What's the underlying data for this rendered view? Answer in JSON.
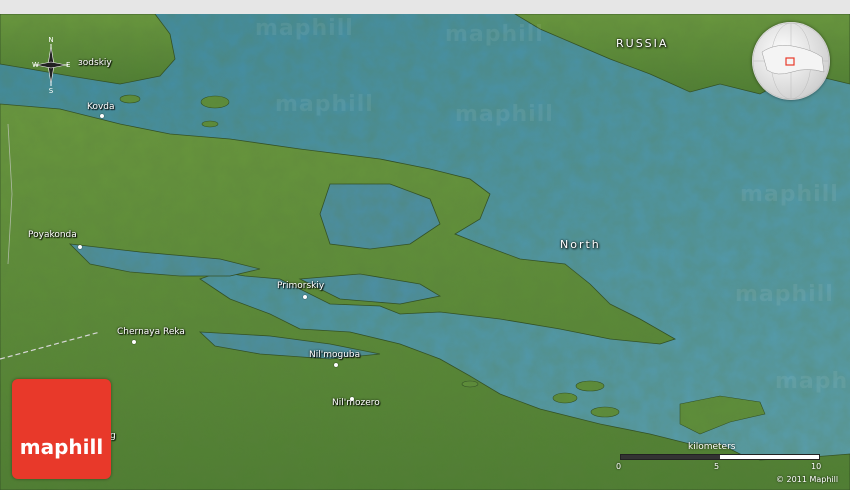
{
  "map": {
    "country_label": "RUSSIA",
    "sea_label": "North",
    "places": [
      {
        "name": "Zelenoborskiy",
        "display": "зodskiy"
      },
      {
        "name": "Kovda",
        "display": "Kovda"
      },
      {
        "name": "Poyakonda",
        "display": "Poyakonda"
      },
      {
        "name": "Primorskiy",
        "display": "Primorskiy"
      },
      {
        "name": "Chernaya Reka",
        "display": "Chernaya Reka"
      },
      {
        "name": "Nil'moguba",
        "display": "Nil'moguba"
      },
      {
        "name": "Nil'mozero",
        "display": "Nil'mozero"
      }
    ],
    "partial_label": "g",
    "compass": {
      "n": "N",
      "s": "S",
      "e": "E",
      "w": "W"
    },
    "watermark": "maphill",
    "logo_text": "maphill",
    "scale": {
      "title": "kilometers",
      "ticks": [
        "0",
        "5",
        "10"
      ]
    },
    "copyright": "© 2011 Maphill",
    "colors": {
      "sea": "#4b8fa6",
      "land": "#5e8e3a",
      "logo": "#e8392a",
      "border": "#cfcfcf"
    }
  }
}
